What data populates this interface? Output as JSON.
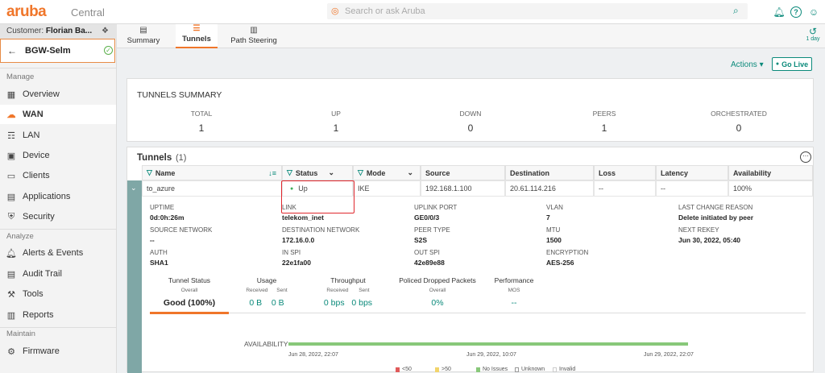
{
  "header": {
    "logo": "aruba",
    "product": "Central",
    "search_placeholder": "Search or ask Aruba"
  },
  "sidebar": {
    "customer_label": "Customer:",
    "customer_name": "Florian Ba...",
    "site": "BGW-Selm",
    "sections": {
      "manage": "Manage",
      "analyze": "Analyze",
      "maintain": "Maintain"
    },
    "items": [
      {
        "label": "Overview",
        "icon": "grid-icon"
      },
      {
        "label": "WAN",
        "icon": "cloud-icon",
        "active": true
      },
      {
        "label": "LAN",
        "icon": "switch-icon"
      },
      {
        "label": "Device",
        "icon": "device-icon"
      },
      {
        "label": "Clients",
        "icon": "clients-icon"
      },
      {
        "label": "Applications",
        "icon": "applications-icon"
      },
      {
        "label": "Security",
        "icon": "shield-icon"
      },
      {
        "label": "Alerts & Events",
        "icon": "bell-icon"
      },
      {
        "label": "Audit Trail",
        "icon": "audit-icon"
      },
      {
        "label": "Tools",
        "icon": "wrench-icon"
      },
      {
        "label": "Reports",
        "icon": "reports-icon"
      },
      {
        "label": "Firmware",
        "icon": "firmware-icon"
      }
    ]
  },
  "tabs": [
    {
      "label": "Summary"
    },
    {
      "label": "Tunnels",
      "active": true
    },
    {
      "label": "Path Steering"
    }
  ],
  "time_range": "1 day",
  "toolbar": {
    "actions": "Actions",
    "golive": "Go Live"
  },
  "summary": {
    "title": "TUNNELS SUMMARY",
    "cols": [
      {
        "label": "TOTAL",
        "value": "1"
      },
      {
        "label": "UP",
        "value": "1"
      },
      {
        "label": "DOWN",
        "value": "0"
      },
      {
        "label": "PEERS",
        "value": "1"
      },
      {
        "label": "ORCHESTRATED",
        "value": "0"
      }
    ]
  },
  "tunnels": {
    "title": "Tunnels",
    "count": "(1)",
    "headers": [
      "Name",
      "Status",
      "Mode",
      "Source",
      "Destination",
      "Loss",
      "Latency",
      "Availability"
    ],
    "row": [
      "to_azure",
      "Up",
      "IKE",
      "192.168.1.100",
      "20.61.114.216",
      "--",
      "--",
      "100%"
    ],
    "details": {
      "uptime": {
        "label": "UPTIME",
        "value": "0d:0h:26m"
      },
      "link": {
        "label": "LINK",
        "value": "telekom_inet"
      },
      "uplink_port": {
        "label": "UPLINK PORT",
        "value": "GE0/0/3"
      },
      "vlan": {
        "label": "VLAN",
        "value": "7"
      },
      "last_change": {
        "label": "LAST CHANGE REASON",
        "value": "Delete initiated by peer"
      },
      "source_network": {
        "label": "SOURCE NETWORK",
        "value": "--"
      },
      "dest_network": {
        "label": "DESTINATION NETWORK",
        "value": "172.16.0.0"
      },
      "peer_type": {
        "label": "PEER TYPE",
        "value": "S2S"
      },
      "mtu": {
        "label": "MTU",
        "value": "1500"
      },
      "next_rekey": {
        "label": "NEXT REKEY",
        "value": "Jun 30, 2022, 05:40"
      },
      "auth": {
        "label": "AUTH",
        "value": "SHA1"
      },
      "in_spi": {
        "label": "IN SPI",
        "value": "22e1fa00"
      },
      "out_spi": {
        "label": "OUT SPI",
        "value": "42e89e88"
      },
      "encryption": {
        "label": "ENCRYPTION",
        "value": "AES-256"
      }
    },
    "metrics": {
      "tunnel_status": {
        "title": "Tunnel Status",
        "sub": "Overall",
        "value": "Good (100%)"
      },
      "usage": {
        "title": "Usage",
        "received": "Received",
        "sent": "Sent",
        "rx": "0 B",
        "tx": "0 B"
      },
      "throughput": {
        "title": "Throughput",
        "received": "Received",
        "sent": "Sent",
        "rx": "0 bps",
        "tx": "0 bps"
      },
      "policed": {
        "title": "Policed Dropped Packets",
        "sub": "Overall",
        "value": "0%"
      },
      "performance": {
        "title": "Performance",
        "sub": "MOS",
        "value": "--"
      }
    },
    "availability": {
      "label": "AVAILABILITY",
      "ticks": [
        "Jun 28, 2022, 22:07",
        "Jun 29, 2022, 10:07",
        "Jun 29, 2022, 22:07"
      ],
      "legend": [
        {
          "label": "<50",
          "color": "#e05a5a"
        },
        {
          "label": ">50",
          "color": "#f2d46b"
        },
        {
          "label": "No Issues",
          "color": "#88c87a"
        },
        {
          "label": "Unknown",
          "color": "#bbbbbb"
        },
        {
          "label": "Invalid",
          "color": "#dddddd"
        }
      ]
    }
  }
}
